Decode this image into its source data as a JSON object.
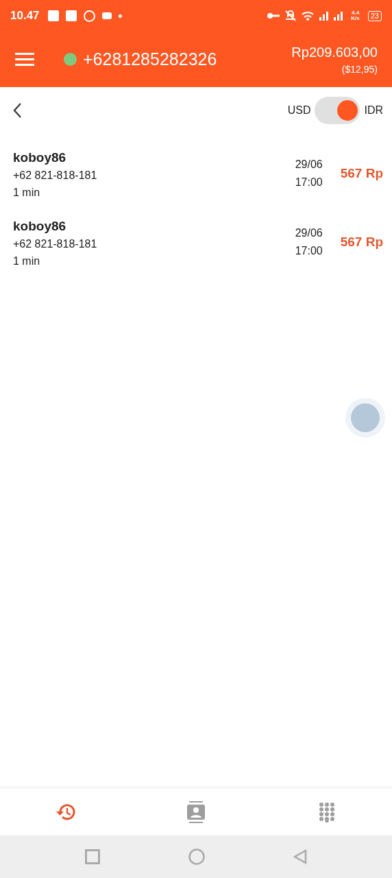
{
  "status_bar": {
    "time": "10.47",
    "speed_value": "4.4",
    "speed_unit": "K/s",
    "battery": "23"
  },
  "header": {
    "online": true,
    "phone": "+6281285282326",
    "balance": "Rp209.603,00",
    "balance_usd": "($12,95)"
  },
  "currency_toggle": {
    "left_label": "USD",
    "right_label": "IDR",
    "on": true
  },
  "calls": [
    {
      "name": "koboy86",
      "number": "+62 821-818-181",
      "duration": "1 min",
      "date": "29/06",
      "time": "17:00",
      "cost": "567 Rp"
    },
    {
      "name": "koboy86",
      "number": "+62 821-818-181",
      "duration": "1 min",
      "date": "29/06",
      "time": "17:00",
      "cost": "567 Rp"
    }
  ],
  "bottom_tabs": [
    {
      "kind": "history",
      "selected": true
    },
    {
      "kind": "contacts",
      "selected": false
    },
    {
      "kind": "dialpad",
      "selected": false
    }
  ]
}
